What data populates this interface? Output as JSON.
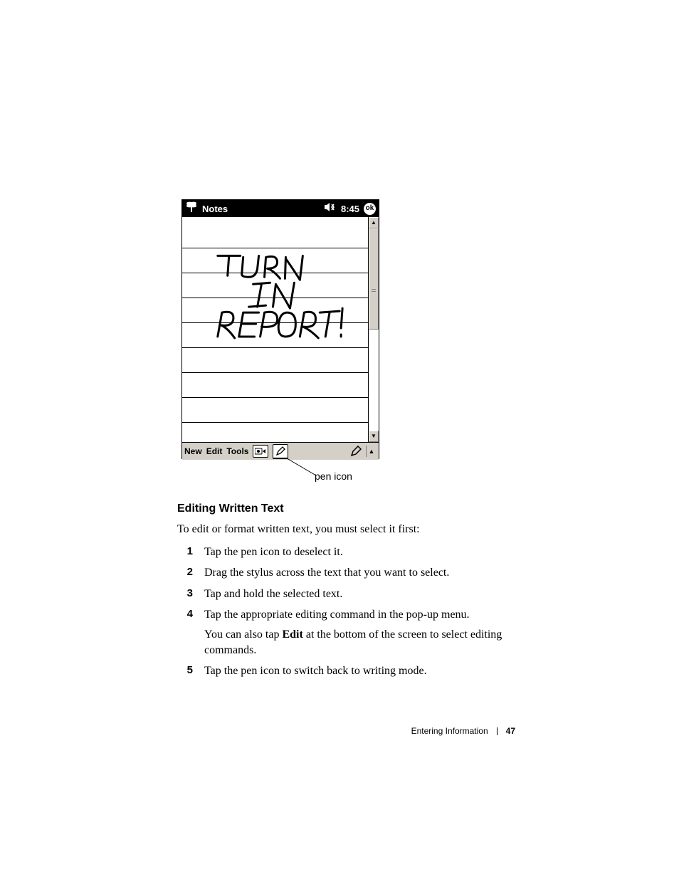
{
  "pda": {
    "title": "Notes",
    "time": "8:45",
    "ok": "ok",
    "handwriting_lines": [
      "TURN",
      "IN",
      "REPORT!"
    ],
    "menubar": {
      "new": "New",
      "edit": "Edit",
      "tools": "Tools"
    }
  },
  "callout": "pen icon",
  "section_heading": "Editing Written Text",
  "intro": "To edit or format written text, you must select it first:",
  "steps": [
    {
      "n": "1",
      "text": "Tap the pen icon to deselect it."
    },
    {
      "n": "2",
      "text": "Drag the stylus across the text that you want to select."
    },
    {
      "n": "3",
      "text": "Tap and hold the selected text."
    },
    {
      "n": "4",
      "text": "Tap the appropriate editing command in the pop-up menu.",
      "sub_prefix": "You can also tap ",
      "sub_bold": "Edit",
      "sub_suffix": " at the bottom of the screen to select editing commands."
    },
    {
      "n": "5",
      "text": "Tap the pen icon to switch back to writing mode."
    }
  ],
  "footer": {
    "chapter": "Entering Information",
    "page": "47"
  }
}
